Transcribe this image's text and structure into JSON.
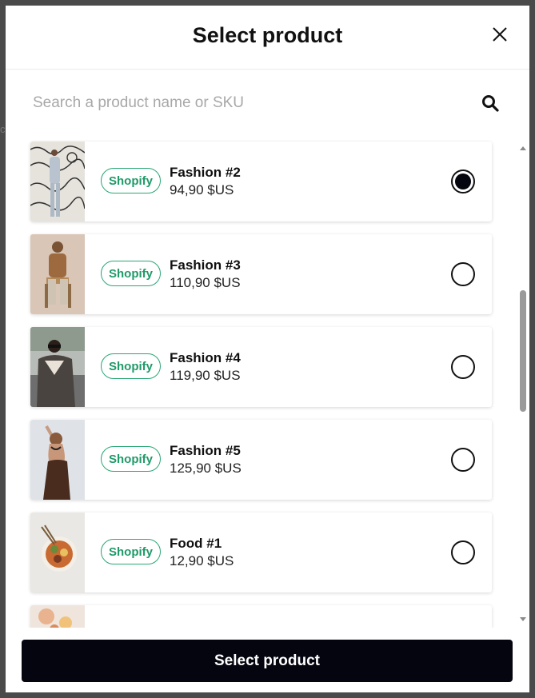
{
  "modal": {
    "title": "Select product",
    "close_icon": "close-icon"
  },
  "search": {
    "placeholder": "Search a product name or SKU",
    "value": "",
    "icon": "search-icon"
  },
  "products": [
    {
      "badge": "Shopify",
      "name": "Fashion #2",
      "price": "94,90 $US",
      "selected": true
    },
    {
      "badge": "Shopify",
      "name": "Fashion #3",
      "price": "110,90 $US",
      "selected": false
    },
    {
      "badge": "Shopify",
      "name": "Fashion #4",
      "price": "119,90 $US",
      "selected": false
    },
    {
      "badge": "Shopify",
      "name": "Fashion #5",
      "price": "125,90 $US",
      "selected": false
    },
    {
      "badge": "Shopify",
      "name": "Food #1",
      "price": "12,90 $US",
      "selected": false
    }
  ],
  "footer": {
    "button_label": "Select product"
  },
  "colors": {
    "accent_badge": "#2aa774",
    "primary_button": "#05050f"
  }
}
